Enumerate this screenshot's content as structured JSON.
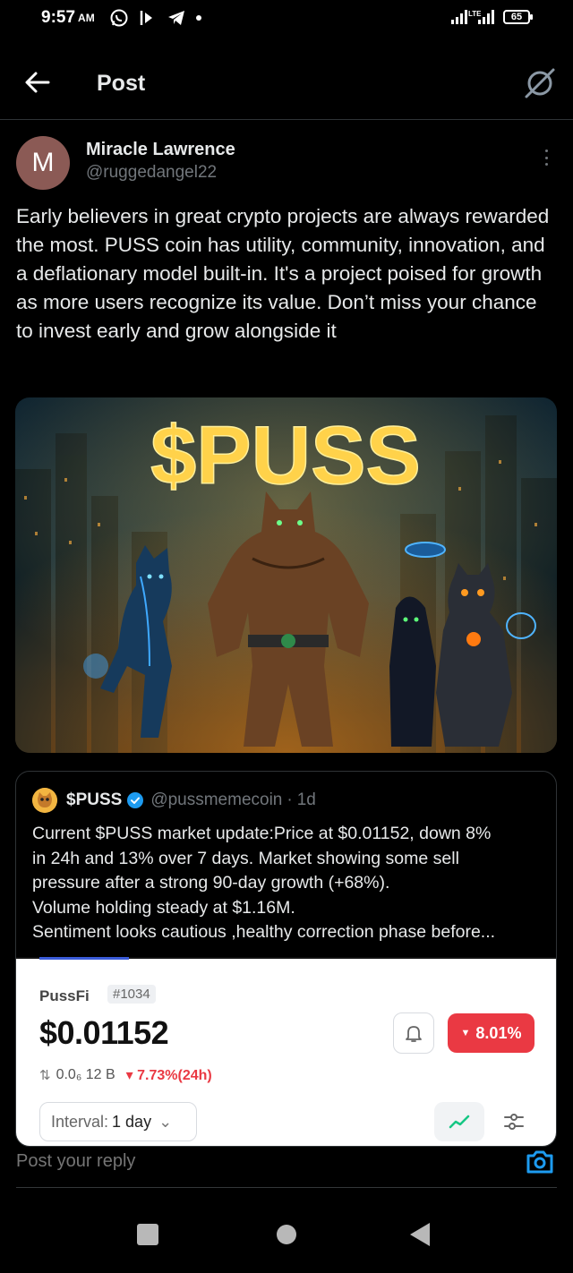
{
  "status_bar": {
    "time": "9:57",
    "ampm": "AM",
    "network": "LTE",
    "battery": "65"
  },
  "header": {
    "title": "Post"
  },
  "post": {
    "author_initial": "M",
    "author_name": "Miracle Lawrence",
    "author_handle": "@ruggedangel22",
    "text": "Early believers in great crypto projects are always rewarded the most. PUSS coin has utility, community, innovation, and a deflationary model built-in. It's a project poised for growth as more users recognize its value. Don’t miss your chance to invest early and grow alongside it",
    "image_title": "$PUSS"
  },
  "quote": {
    "name": "$PUSS",
    "handle": "@pussmemecoin",
    "separator": "·",
    "time": "1d",
    "lines": [
      "Current $PUSS market update:Price at $0.01152, down 8%",
      "in 24h and 13% over 7 days. Market showing some sell",
      "pressure after a strong 90-day growth (+68%).",
      "Volume holding steady at $1.16M.",
      "Sentiment looks cautious ,healthy correction phase before..."
    ],
    "screenshot": {
      "name": "PussFi",
      "rank": "#1034",
      "price": "$0.01152",
      "change_badge": "8.01%",
      "volume": "0.0₆ 12 B",
      "change_24h": "▾ 7.73%(24h)",
      "interval_label": "Interval:",
      "interval_value": "1 day"
    }
  },
  "reply": {
    "placeholder": "Post your reply"
  },
  "colors": {
    "accent": "#1d9bf0",
    "negative": "#ea3943",
    "brand_gold": "#f5c542"
  }
}
